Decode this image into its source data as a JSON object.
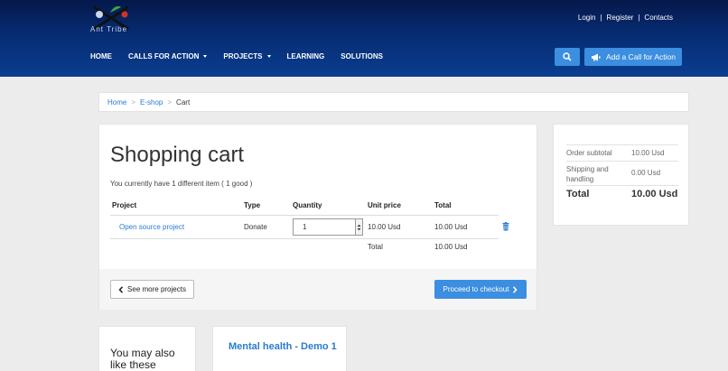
{
  "header": {
    "logo_text": "Ant Tribe",
    "top_links": [
      "Login",
      "Register",
      "Contacts"
    ],
    "nav": [
      {
        "label": "HOME",
        "dropdown": false
      },
      {
        "label": "CALLS FOR ACTION",
        "dropdown": true
      },
      {
        "label": "PROJECTS",
        "dropdown": true
      },
      {
        "label": "LEARNING",
        "dropdown": false
      },
      {
        "label": "SOLUTIONS",
        "dropdown": false
      }
    ],
    "search_icon": "search-icon",
    "cfa_label": "Add a Call for Action",
    "cfa_icon": "megaphone-icon"
  },
  "breadcrumb": {
    "items": [
      "Home",
      "E-shop"
    ],
    "current": "Cart"
  },
  "cart": {
    "title": "Shopping cart",
    "subtitle": "You currently have 1 different item ( 1 good )",
    "columns": [
      "Project",
      "Type",
      "Quantity",
      "Unit price",
      "Total"
    ],
    "row": {
      "project": "Open source project",
      "type": "Donate",
      "quantity": "1",
      "unit_price": "10.00 Usd",
      "total": "10.00 Usd"
    },
    "total_label": "Total",
    "total_value": "10.00 Usd",
    "see_more_label": "See more projects",
    "checkout_label": "Proceed to checkout"
  },
  "summary": {
    "subtotal_label": "Order subtotal",
    "subtotal_value": "10.00 Usd",
    "shipping_label": "Shipping and handling",
    "shipping_value": "0.00 Usd",
    "total_label": "Total",
    "total_value": "10.00 Usd"
  },
  "also": {
    "title": "You may also like these"
  },
  "project_card": {
    "title": "Mental health - Demo 1"
  },
  "colors": {
    "header_top": "#05184a",
    "header_bottom": "#0a3d8f",
    "accent": "#3b8ee0",
    "link": "#2a7bd1"
  }
}
